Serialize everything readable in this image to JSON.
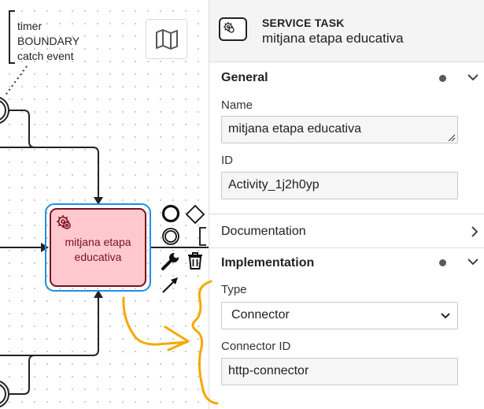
{
  "canvas": {
    "annotation_lines": [
      "timer",
      "BOUNDARY",
      "catch event"
    ],
    "task_label_lines": [
      "mitjana etapa",
      "educativa"
    ],
    "map_icon": "map-icon",
    "task_icon": "gear-icon",
    "context_pad_icons": [
      "end-event-icon",
      "gateway-icon",
      "intermediate-event-icon",
      "text-annotation-icon",
      "wrench-icon",
      "trash-icon",
      "connect-arrow-icon"
    ]
  },
  "panel": {
    "header": {
      "type": "SERVICE TASK",
      "name": "mitjana etapa educativa",
      "icon": "service-task-icon"
    },
    "general": {
      "title": "General",
      "name_label": "Name",
      "name_value": "mitjana etapa educativa",
      "id_label": "ID",
      "id_value": "Activity_1j2h0yp"
    },
    "documentation": {
      "title": "Documentation"
    },
    "implementation": {
      "title": "Implementation",
      "type_label": "Type",
      "type_value": "Connector",
      "connector_id_label": "Connector ID",
      "connector_id_value": "http-connector"
    }
  },
  "colors": {
    "selection": "#1f8fe0",
    "task_fill": "#ffc9cf",
    "task_stroke": "#7a1020",
    "annotation_highlight": "#f5a800"
  }
}
